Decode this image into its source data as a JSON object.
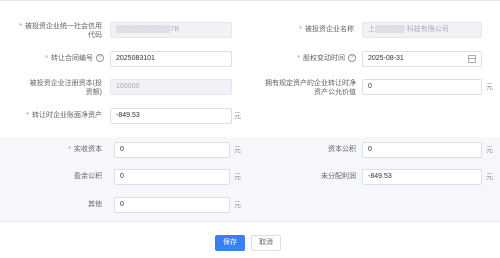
{
  "form": {
    "credit_code": {
      "label": "被投资企业统一社会信用代码",
      "value": "▒▒▒▒▒▒▒▒▒▒▒7B"
    },
    "company_name": {
      "label": "被投资企业名称",
      "value": "上▒▒▒▒▒▒ 科技有限公司"
    },
    "contract_no": {
      "label": "转让合同编号",
      "value": "2025083101"
    },
    "equity_change_time": {
      "label": "股权变动时间",
      "value": "2025-08-31"
    },
    "registered_capital": {
      "label": "被投资企业注册资本(投资额)",
      "value": "100000"
    },
    "fair_value": {
      "label": "拥有规定资产的企业转让时净资产公允价值",
      "value": "0"
    },
    "book_net_assets": {
      "label": "转让时企业账面净资产",
      "value": "-849.53"
    },
    "paid_in_capital": {
      "label": "实收资本",
      "value": "0"
    },
    "capital_reserve": {
      "label": "资本公积",
      "value": "0"
    },
    "surplus_reserve": {
      "label": "盈余公积",
      "value": "0"
    },
    "undistributed_profit": {
      "label": "未分配利润",
      "value": "-849.53"
    },
    "other": {
      "label": "其他",
      "value": "0"
    }
  },
  "unit": "元",
  "required_mark": "*",
  "help_mark": "?",
  "buttons": {
    "save": "保存",
    "cancel": "取消"
  },
  "colors": {
    "primary": "#3a7ff6",
    "required": "#f56c6c"
  },
  "icons": {
    "help": "question-circle-icon",
    "date": "calendar-icon"
  }
}
